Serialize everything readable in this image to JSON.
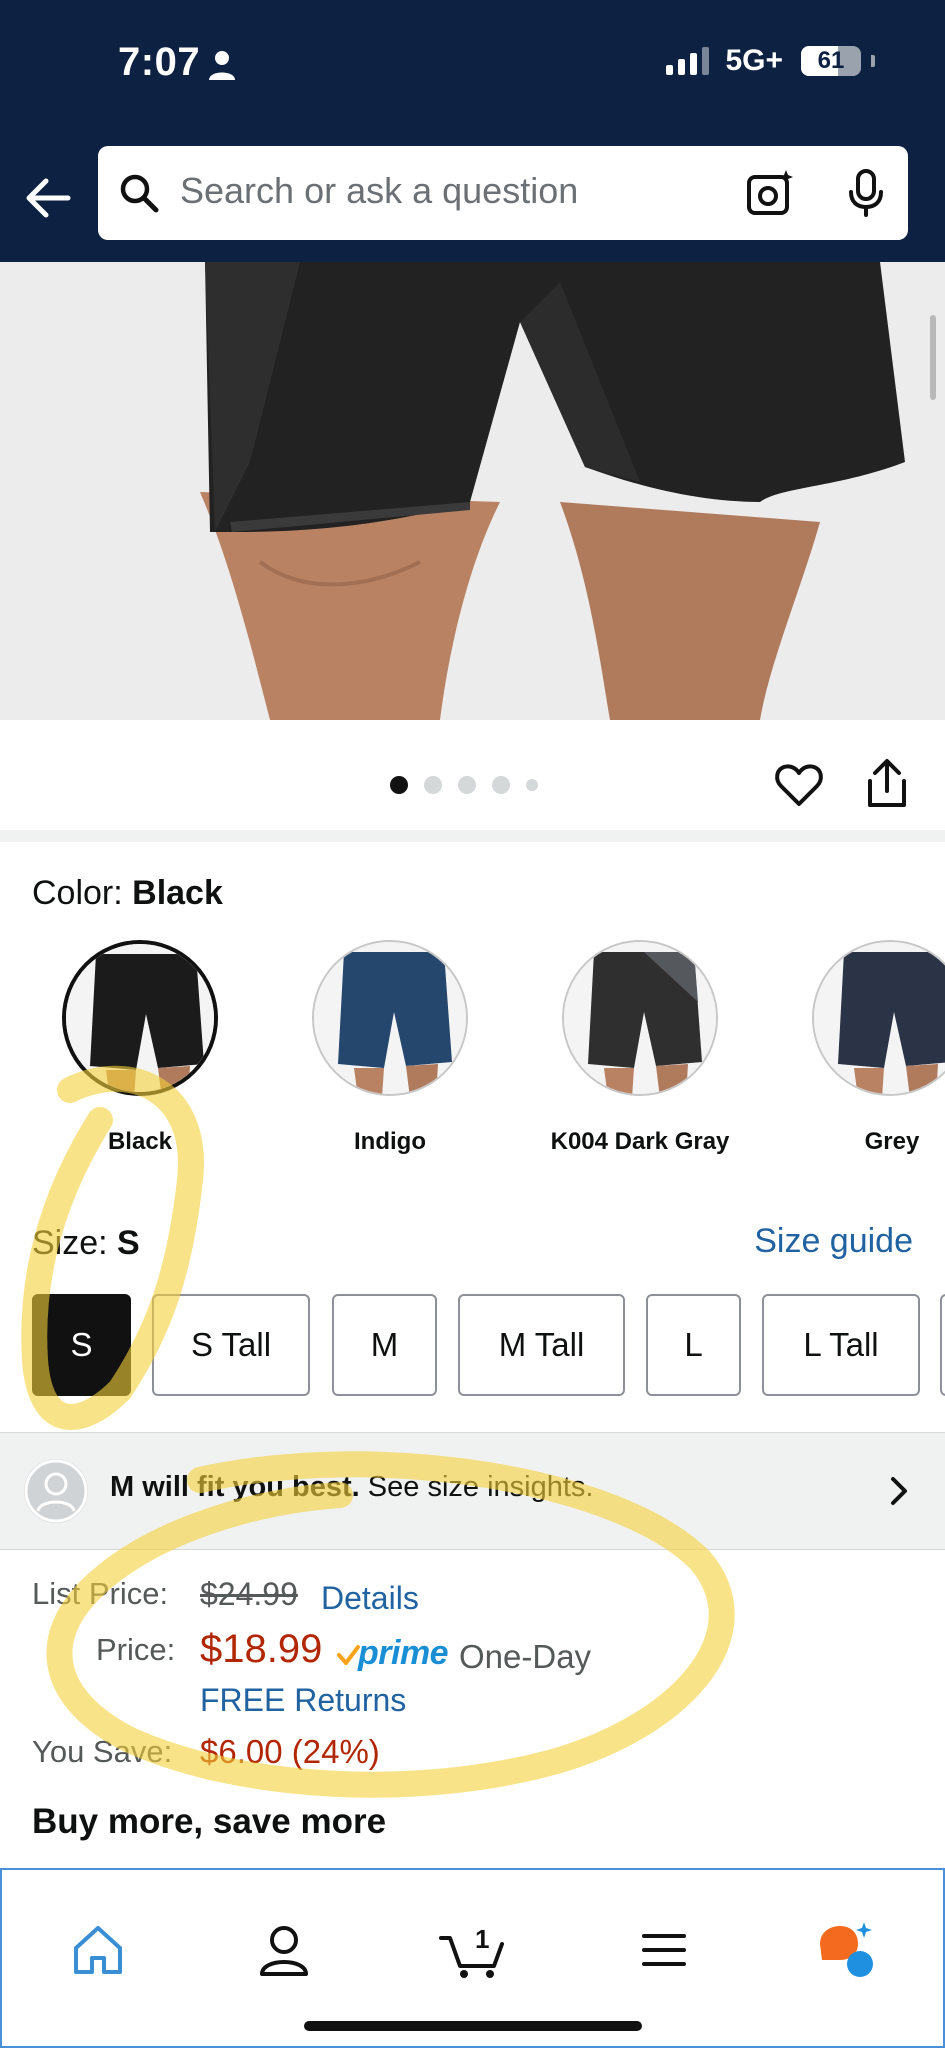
{
  "status_bar": {
    "time": "7:07",
    "network": "5G+",
    "battery": "61"
  },
  "search": {
    "placeholder": "Search or ask a question"
  },
  "gallery": {
    "image_count": 5,
    "active_index": 0
  },
  "color": {
    "label": "Color: ",
    "selected": "Black",
    "options": [
      "Black",
      "Indigo",
      "K004 Dark Gray",
      "Grey"
    ]
  },
  "size": {
    "label": "Size: ",
    "selected": "S",
    "guide_link": "Size guide",
    "options": [
      "S",
      "S Tall",
      "M",
      "M Tall",
      "L",
      "L Tall"
    ]
  },
  "fit": {
    "bold": "M will fit you best.",
    "rest": " See size insights."
  },
  "pricing": {
    "list_label": "List Price:",
    "list_price": "$24.99",
    "details_link": "Details",
    "price_label": "Price:",
    "price": "$18.99",
    "prime": "prime",
    "delivery": "One-Day",
    "returns": "FREE Returns",
    "save_label": "You Save:",
    "save_value": "$6.00 (24%)"
  },
  "buy_more": {
    "heading": "Buy more, save more"
  },
  "bottom_nav": {
    "items": [
      "home-icon",
      "account-icon",
      "cart-icon",
      "menu-icon",
      "rufus-icon"
    ],
    "cart_count": "1"
  },
  "colors": {
    "header_bg": "#0d2142",
    "link": "#2162a1",
    "price": "#b12704",
    "prime": "#1a8ed4",
    "highlighter": "#f5d13a"
  }
}
